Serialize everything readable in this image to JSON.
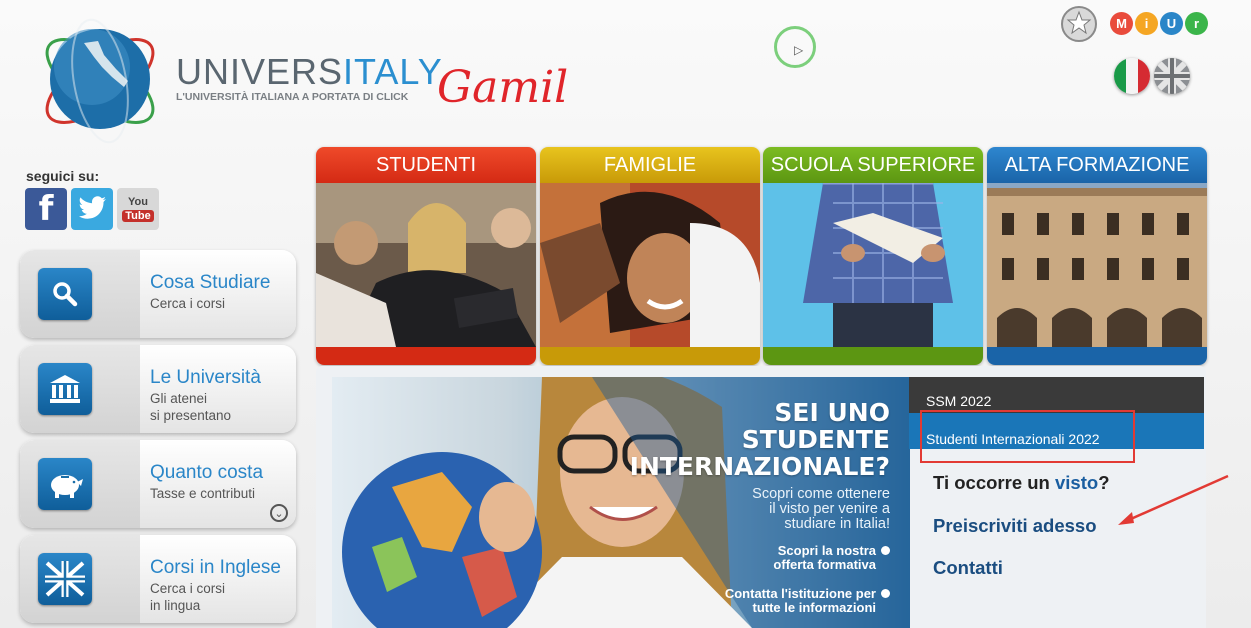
{
  "brand": {
    "name_part1": "UNIVERS",
    "name_part2": "ITALY",
    "tagline": "L'UNIVERSITÀ ITALIANA A PORTATA DI CLICK"
  },
  "annotation": {
    "handwritten": "Gamil"
  },
  "header": {
    "miur_letters": [
      "M",
      "i",
      "U",
      "r"
    ],
    "miur_colors": [
      "#e94b3c",
      "#f5a623",
      "#2a86c8",
      "#3bb54a"
    ]
  },
  "social": {
    "label": "seguici su:",
    "facebook": "f",
    "youtube_top": "You",
    "youtube_bottom": "Tube"
  },
  "nav": [
    {
      "title": "Cosa Studiare",
      "subtitle": "Cerca i corsi",
      "icon": "search-icon"
    },
    {
      "title": "Le Università",
      "subtitle": "Gli atenei\nsi presentano",
      "icon": "university-icon"
    },
    {
      "title": "Quanto costa",
      "subtitle": "Tasse e contributi",
      "icon": "piggy-bank-icon",
      "more": "⌄"
    },
    {
      "title": "Corsi in Inglese",
      "subtitle": "Cerca i corsi\nin lingua",
      "icon": "uk-flag-icon"
    }
  ],
  "tiles": [
    {
      "label": "STUDENTI",
      "color": "#e8321f"
    },
    {
      "label": "FAMIGLIE",
      "color": "#e0b411"
    },
    {
      "label": "SCUOLA SUPERIORE",
      "color": "#6aa51c"
    },
    {
      "label": "ALTA FORMAZIONE",
      "color": "#2176bd"
    }
  ],
  "banner": {
    "title_lines": [
      "SEI UNO",
      "STUDENTE",
      "INTERNAZIONALE?"
    ],
    "subtitle_lines": [
      "Scopri come ottenere",
      "il visto per venire a",
      "studiare in Italia!"
    ],
    "link1_lines": [
      "Scopri la nostra",
      "offerta formativa"
    ],
    "link2_lines": [
      "Contatta l'istituzione per",
      "tutte le informazioni"
    ]
  },
  "right_panel": {
    "item1": "SSM 2022",
    "item2": "Studenti Internazionali 2022",
    "question_pre": "Ti occorre un ",
    "question_link": "visto",
    "question_post": "?",
    "link_preiscriviti": "Preiscriviti adesso",
    "link_contatti": "Contatti"
  }
}
